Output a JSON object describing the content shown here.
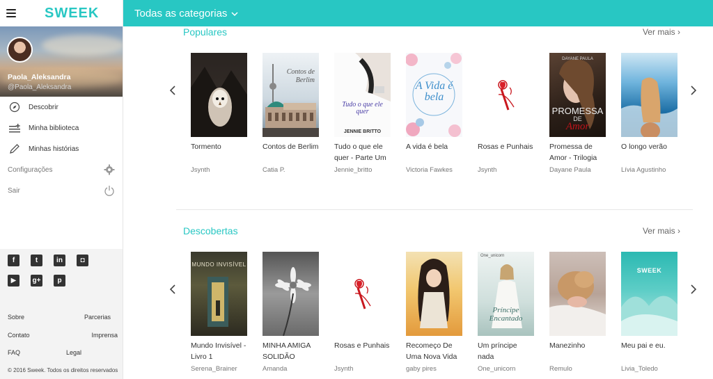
{
  "app": {
    "logo": "SWEEK"
  },
  "profile": {
    "name": "Paola_Aleksandra",
    "handle": "@Paola_Aleksandra"
  },
  "nav": {
    "discover": "Descobrir",
    "library": "Minha biblioteca",
    "stories": "Minhas histórias",
    "settings": "Configurações",
    "logout": "Sair"
  },
  "social_icons": [
    "facebook-icon",
    "twitter-icon",
    "linkedin-icon",
    "instagram-icon",
    "youtube-icon",
    "google-plus-icon",
    "pinterest-icon"
  ],
  "footer": {
    "about": "Sobre",
    "partners": "Parcerias",
    "contact": "Contato",
    "press": "Imprensa",
    "faq": "FAQ",
    "legal": "Legal",
    "copyright": "© 2016 Sweek. Todos os direitos reservados"
  },
  "header": {
    "category_title": "Todas as categorias"
  },
  "sections": {
    "popular": {
      "title": "Populares",
      "see_more": "Ver mais",
      "books": [
        {
          "title": "Tormento",
          "author": "Jsynth"
        },
        {
          "title": "Contos de Berlim",
          "author": "Catia P."
        },
        {
          "title": "Tudo o que ele quer - Parte Um",
          "author": "Jennie_britto"
        },
        {
          "title": "A vida é bela",
          "author": "Victoria Fawkes"
        },
        {
          "title": "Rosas e Punhais",
          "author": "Jsynth"
        },
        {
          "title": "Promessa de Amor - Trilogia",
          "author": "Dayane Paula"
        },
        {
          "title": "O longo verão",
          "author": "Lívia Agustinho"
        }
      ]
    },
    "discoveries": {
      "title": "Descobertas",
      "see_more": "Ver mais",
      "books": [
        {
          "title": "Mundo Invisível - Livro 1",
          "author": "Serena_Brainer"
        },
        {
          "title": "MINHA AMIGA SOLIDÃO",
          "author": "Amanda"
        },
        {
          "title": "Rosas e Punhais",
          "author": "Jsynth"
        },
        {
          "title": "Recomeço De Uma Nova Vida",
          "author": "gaby pires"
        },
        {
          "title": "Um príncipe nada",
          "author": "One_unicorn"
        },
        {
          "title": "Manezinho",
          "author": "Remulo"
        },
        {
          "title": "Meu pai e eu.",
          "author": "Livia_Toledo"
        }
      ]
    }
  },
  "cover_text": {
    "contos": "Contos de Berlim",
    "tudo_author": "JENNIE BRITTO",
    "tudo_big": "Tudo o que ele quer",
    "vida": "A Vida é bela",
    "promessa_title": "PROMESSA",
    "promessa_de": "DE",
    "promessa_amor": "Amor",
    "promessa_author": "DAYANE PAULA",
    "mundo": "MUNDO INVISÍVEL",
    "principe": "Príncipe Encantado",
    "meu_logo": "SWEEK",
    "principe_author": "One_unicorn"
  },
  "colors": {
    "accent": "#28c7c3"
  }
}
